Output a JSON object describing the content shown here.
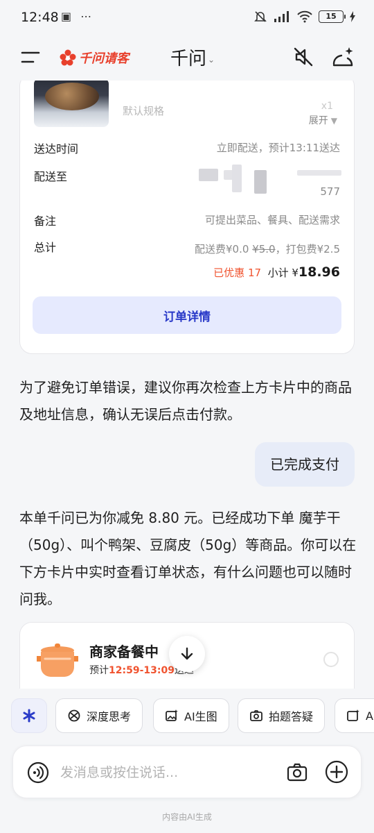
{
  "status_bar": {
    "time": "12:48",
    "left_icons": "▣ ⋯",
    "battery": "15"
  },
  "header": {
    "logo_text": "千问请客",
    "title": "千问",
    "title_chevron": "⌄"
  },
  "order_card": {
    "spec": "默认规格",
    "qty": "x1",
    "expand_label": "展开",
    "delivery_time_label": "送达时间",
    "delivery_time_value": "立即配送，预计13:11送达",
    "deliver_to_label": "配送至",
    "deliver_to_suffix": "577",
    "remark_label": "备注",
    "remark_value": "可提出菜品、餐具、配送需求",
    "total_label": "总计",
    "fee_prefix": "配送费¥0.0",
    "fee_original": "¥5.0",
    "fee_suffix": "，打包费¥2.5",
    "discount": "已优惠 17",
    "subtotal_label": "小计 ¥",
    "subtotal_value": "18.96",
    "detail_button": "订单详情"
  },
  "messages": {
    "assistant_1": "为了避免订单错误，建议你再次检查上方卡片中的商品及地址信息，确认无误后点击付款。",
    "user_1": "已完成支付",
    "assistant_2": "本单千问已为你减免 8.80 元。已经成功下单 魔芋干（50g）、叫个鸭架、豆腐皮（50g）等商品。你可以在下方卡片中实时查看订单状态，有什么问题也可以随时问我。"
  },
  "status_card": {
    "title": "商家备餐中",
    "sub_prefix": "预计",
    "time_range": "12:59-13:09",
    "sub_suffix": "送达"
  },
  "chips": [
    {
      "label": "深度思考"
    },
    {
      "label": "AI生图"
    },
    {
      "label": "拍题答疑"
    },
    {
      "label": "AI"
    }
  ],
  "input": {
    "placeholder": "发消息或按住说话..."
  },
  "footer_note": "内容由AI生成"
}
